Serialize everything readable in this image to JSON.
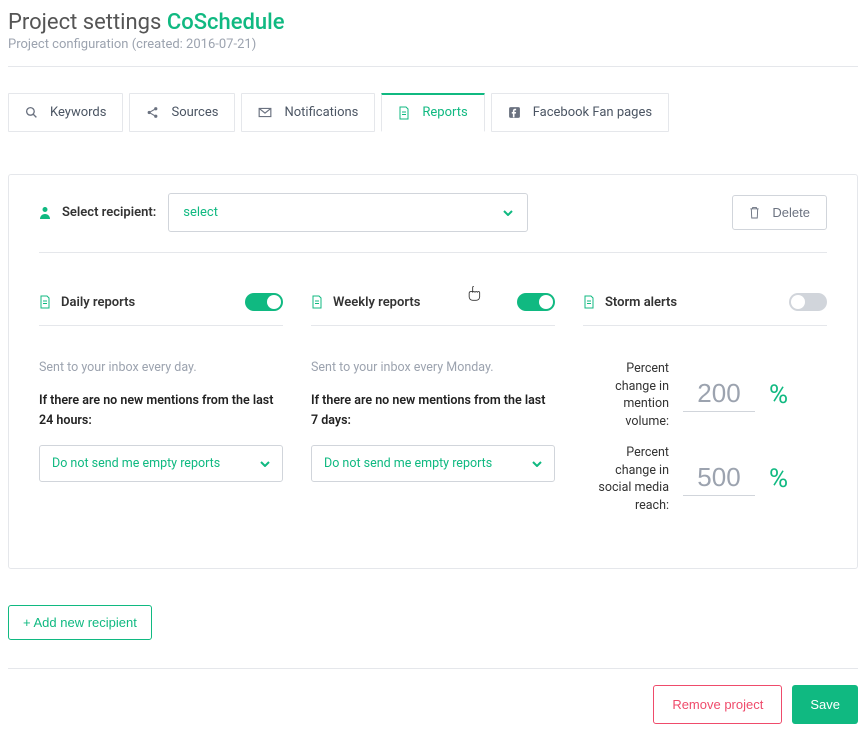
{
  "header": {
    "title_prefix": "Project settings",
    "brand": "CoSchedule",
    "subtitle": "Project configuration (created: 2016-07-21)"
  },
  "tabs": {
    "keywords": "Keywords",
    "sources": "Sources",
    "notifications": "Notifications",
    "reports": "Reports",
    "facebook": "Facebook Fan pages"
  },
  "recipient": {
    "label": "Select recipient:",
    "select_placeholder": "select",
    "delete_label": "Delete"
  },
  "daily": {
    "title": "Daily reports",
    "desc": "Sent to your inbox every day.",
    "prompt": "If there are no new mentions from the last 24 hours:",
    "select_value": "Do not send me empty reports"
  },
  "weekly": {
    "title": "Weekly reports",
    "desc": "Sent to your inbox every Monday.",
    "prompt": "If there are no new mentions from the last 7 days:",
    "select_value": "Do not send me empty reports"
  },
  "storm": {
    "title": "Storm alerts",
    "metric1_label": "Percent change in mention volume:",
    "metric1_value": "200",
    "metric2_label": "Percent change in social media reach:",
    "metric2_value": "500",
    "percent_symbol": "%"
  },
  "add_recipient": "+ Add new recipient",
  "footer": {
    "remove": "Remove project",
    "save": "Save"
  }
}
